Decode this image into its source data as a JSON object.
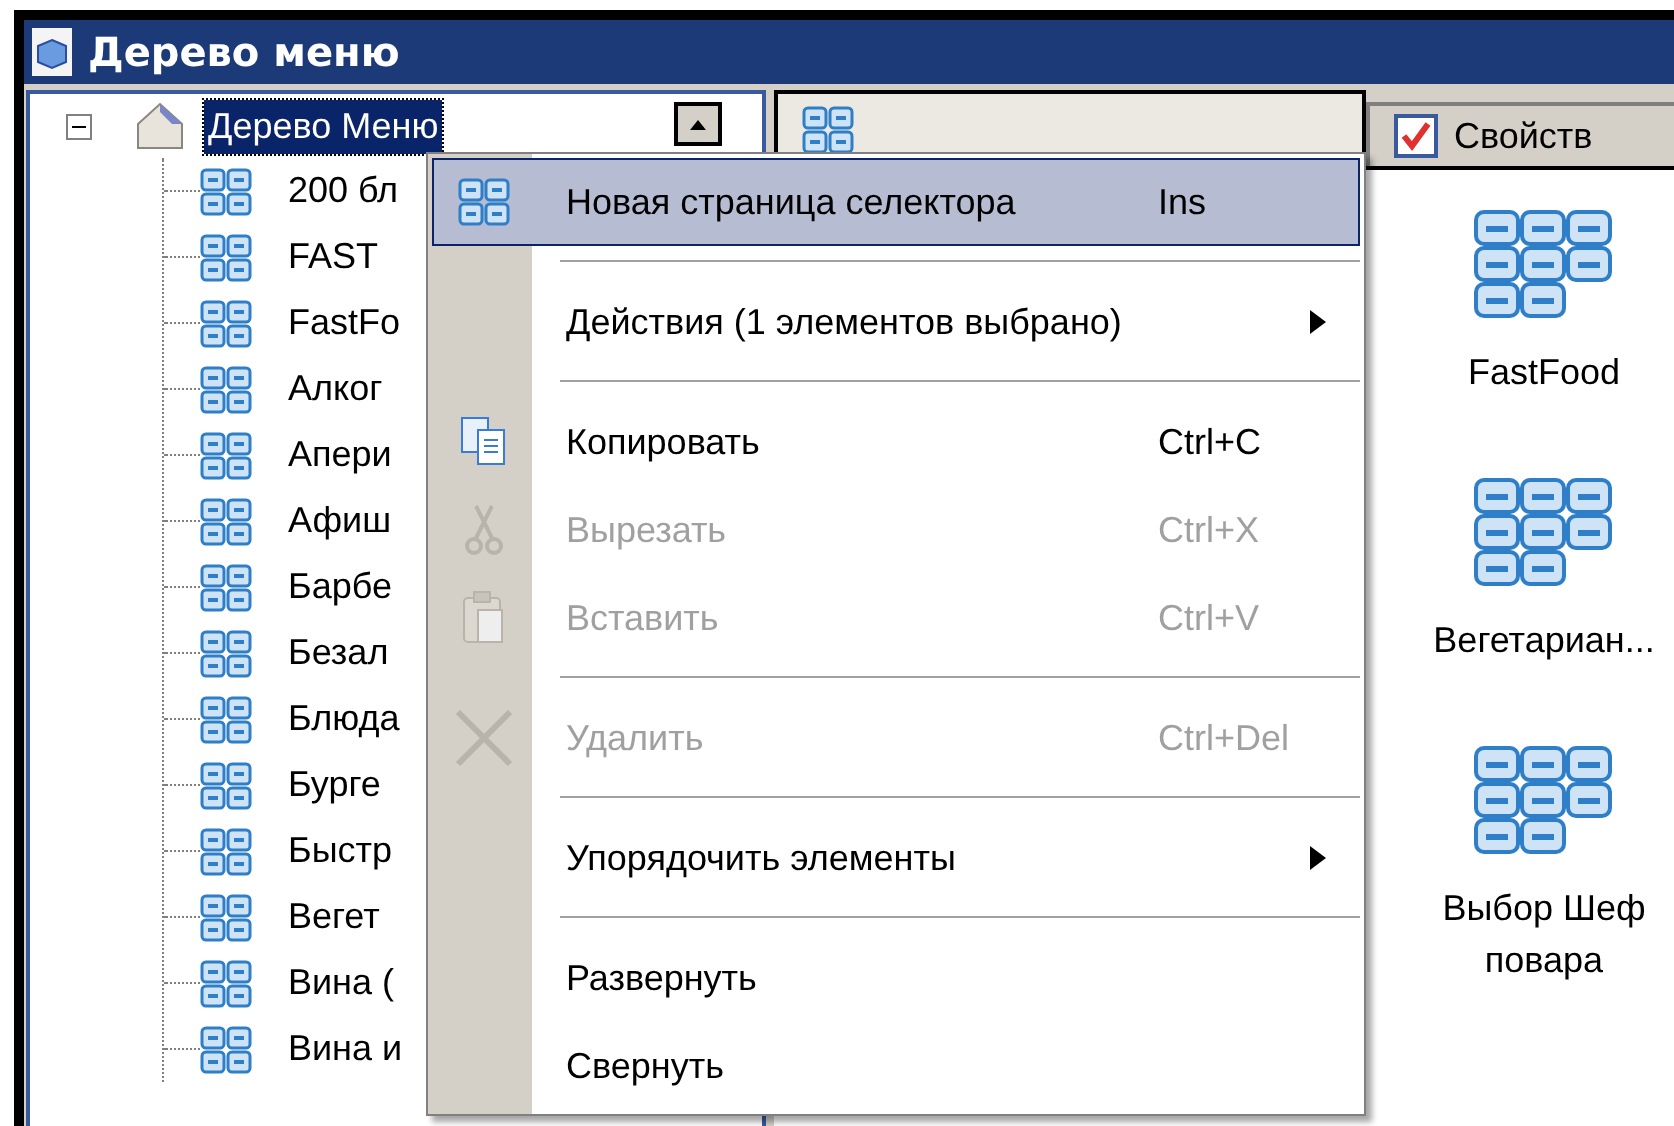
{
  "window": {
    "title": "Дерево меню"
  },
  "tree": {
    "root": {
      "label": "Дерево Меню",
      "expanded": true,
      "selected": true,
      "children": [
        {
          "label": "200 бл"
        },
        {
          "label": "FAST"
        },
        {
          "label": "FastFo"
        },
        {
          "label": "Алког"
        },
        {
          "label": "Апери"
        },
        {
          "label": "Афиш"
        },
        {
          "label": "Барбе"
        },
        {
          "label": "Безал"
        },
        {
          "label": "Блюда"
        },
        {
          "label": "Бурге"
        },
        {
          "label": "Быстр"
        },
        {
          "label": "Вегет"
        },
        {
          "label": "Вина ("
        },
        {
          "label": "Вина и"
        }
      ]
    }
  },
  "tabs": [
    {
      "selected": true
    },
    {
      "label": "Свойств",
      "selected": false
    }
  ],
  "pages": [
    {
      "label": "FastFood"
    },
    {
      "label": "Вегетариан..."
    },
    {
      "label": "Выбор Шеф повара"
    }
  ],
  "context_menu": [
    {
      "kind": "item",
      "label": "Новая страница селектора",
      "shortcut": "Ins",
      "selected": true,
      "disabled": false,
      "submenu": false
    },
    {
      "kind": "separator"
    },
    {
      "kind": "item",
      "label": "Действия (1 элементов выбрано)",
      "selected": false,
      "disabled": false,
      "submenu": true
    },
    {
      "kind": "separator"
    },
    {
      "kind": "item",
      "label": "Копировать",
      "shortcut": "Ctrl+C",
      "selected": false,
      "disabled": false,
      "submenu": false
    },
    {
      "kind": "item",
      "label": "Вырезать",
      "shortcut": "Ctrl+X",
      "selected": false,
      "disabled": true,
      "submenu": false
    },
    {
      "kind": "item",
      "label": "Вставить",
      "shortcut": "Ctrl+V",
      "selected": false,
      "disabled": true,
      "submenu": false
    },
    {
      "kind": "separator"
    },
    {
      "kind": "item",
      "label": "Удалить",
      "shortcut": "Ctrl+Del",
      "selected": false,
      "disabled": true,
      "submenu": false
    },
    {
      "kind": "separator"
    },
    {
      "kind": "item",
      "label": "Упорядочить элементы",
      "selected": false,
      "disabled": false,
      "submenu": true
    },
    {
      "kind": "separator"
    },
    {
      "kind": "item",
      "label": "Развернуть",
      "selected": false,
      "disabled": false,
      "submenu": false
    },
    {
      "kind": "item",
      "label": "Свернуть",
      "selected": false,
      "disabled": false,
      "submenu": false
    }
  ]
}
